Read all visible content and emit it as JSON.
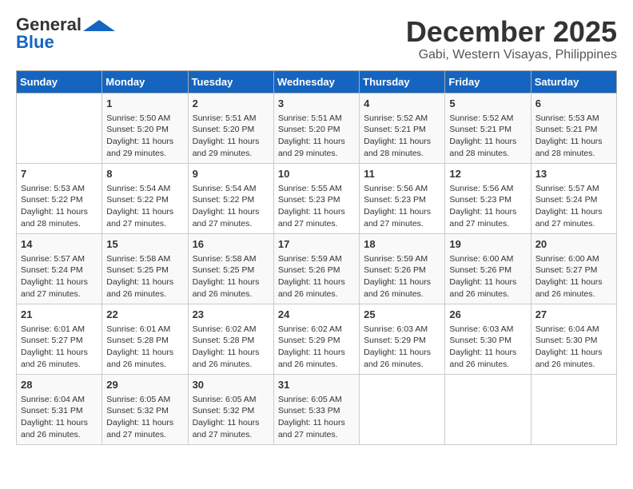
{
  "header": {
    "logo_line1": "General",
    "logo_line2": "Blue",
    "month": "December 2025",
    "location": "Gabi, Western Visayas, Philippines"
  },
  "weekdays": [
    "Sunday",
    "Monday",
    "Tuesday",
    "Wednesday",
    "Thursday",
    "Friday",
    "Saturday"
  ],
  "weeks": [
    [
      {
        "day": "",
        "info": ""
      },
      {
        "day": "1",
        "info": "Sunrise: 5:50 AM\nSunset: 5:20 PM\nDaylight: 11 hours\nand 29 minutes."
      },
      {
        "day": "2",
        "info": "Sunrise: 5:51 AM\nSunset: 5:20 PM\nDaylight: 11 hours\nand 29 minutes."
      },
      {
        "day": "3",
        "info": "Sunrise: 5:51 AM\nSunset: 5:20 PM\nDaylight: 11 hours\nand 29 minutes."
      },
      {
        "day": "4",
        "info": "Sunrise: 5:52 AM\nSunset: 5:21 PM\nDaylight: 11 hours\nand 28 minutes."
      },
      {
        "day": "5",
        "info": "Sunrise: 5:52 AM\nSunset: 5:21 PM\nDaylight: 11 hours\nand 28 minutes."
      },
      {
        "day": "6",
        "info": "Sunrise: 5:53 AM\nSunset: 5:21 PM\nDaylight: 11 hours\nand 28 minutes."
      }
    ],
    [
      {
        "day": "7",
        "info": "Sunrise: 5:53 AM\nSunset: 5:22 PM\nDaylight: 11 hours\nand 28 minutes."
      },
      {
        "day": "8",
        "info": "Sunrise: 5:54 AM\nSunset: 5:22 PM\nDaylight: 11 hours\nand 27 minutes."
      },
      {
        "day": "9",
        "info": "Sunrise: 5:54 AM\nSunset: 5:22 PM\nDaylight: 11 hours\nand 27 minutes."
      },
      {
        "day": "10",
        "info": "Sunrise: 5:55 AM\nSunset: 5:23 PM\nDaylight: 11 hours\nand 27 minutes."
      },
      {
        "day": "11",
        "info": "Sunrise: 5:56 AM\nSunset: 5:23 PM\nDaylight: 11 hours\nand 27 minutes."
      },
      {
        "day": "12",
        "info": "Sunrise: 5:56 AM\nSunset: 5:23 PM\nDaylight: 11 hours\nand 27 minutes."
      },
      {
        "day": "13",
        "info": "Sunrise: 5:57 AM\nSunset: 5:24 PM\nDaylight: 11 hours\nand 27 minutes."
      }
    ],
    [
      {
        "day": "14",
        "info": "Sunrise: 5:57 AM\nSunset: 5:24 PM\nDaylight: 11 hours\nand 27 minutes."
      },
      {
        "day": "15",
        "info": "Sunrise: 5:58 AM\nSunset: 5:25 PM\nDaylight: 11 hours\nand 26 minutes."
      },
      {
        "day": "16",
        "info": "Sunrise: 5:58 AM\nSunset: 5:25 PM\nDaylight: 11 hours\nand 26 minutes."
      },
      {
        "day": "17",
        "info": "Sunrise: 5:59 AM\nSunset: 5:26 PM\nDaylight: 11 hours\nand 26 minutes."
      },
      {
        "day": "18",
        "info": "Sunrise: 5:59 AM\nSunset: 5:26 PM\nDaylight: 11 hours\nand 26 minutes."
      },
      {
        "day": "19",
        "info": "Sunrise: 6:00 AM\nSunset: 5:26 PM\nDaylight: 11 hours\nand 26 minutes."
      },
      {
        "day": "20",
        "info": "Sunrise: 6:00 AM\nSunset: 5:27 PM\nDaylight: 11 hours\nand 26 minutes."
      }
    ],
    [
      {
        "day": "21",
        "info": "Sunrise: 6:01 AM\nSunset: 5:27 PM\nDaylight: 11 hours\nand 26 minutes."
      },
      {
        "day": "22",
        "info": "Sunrise: 6:01 AM\nSunset: 5:28 PM\nDaylight: 11 hours\nand 26 minutes."
      },
      {
        "day": "23",
        "info": "Sunrise: 6:02 AM\nSunset: 5:28 PM\nDaylight: 11 hours\nand 26 minutes."
      },
      {
        "day": "24",
        "info": "Sunrise: 6:02 AM\nSunset: 5:29 PM\nDaylight: 11 hours\nand 26 minutes."
      },
      {
        "day": "25",
        "info": "Sunrise: 6:03 AM\nSunset: 5:29 PM\nDaylight: 11 hours\nand 26 minutes."
      },
      {
        "day": "26",
        "info": "Sunrise: 6:03 AM\nSunset: 5:30 PM\nDaylight: 11 hours\nand 26 minutes."
      },
      {
        "day": "27",
        "info": "Sunrise: 6:04 AM\nSunset: 5:30 PM\nDaylight: 11 hours\nand 26 minutes."
      }
    ],
    [
      {
        "day": "28",
        "info": "Sunrise: 6:04 AM\nSunset: 5:31 PM\nDaylight: 11 hours\nand 26 minutes."
      },
      {
        "day": "29",
        "info": "Sunrise: 6:05 AM\nSunset: 5:32 PM\nDaylight: 11 hours\nand 27 minutes."
      },
      {
        "day": "30",
        "info": "Sunrise: 6:05 AM\nSunset: 5:32 PM\nDaylight: 11 hours\nand 27 minutes."
      },
      {
        "day": "31",
        "info": "Sunrise: 6:05 AM\nSunset: 5:33 PM\nDaylight: 11 hours\nand 27 minutes."
      },
      {
        "day": "",
        "info": ""
      },
      {
        "day": "",
        "info": ""
      },
      {
        "day": "",
        "info": ""
      }
    ]
  ]
}
